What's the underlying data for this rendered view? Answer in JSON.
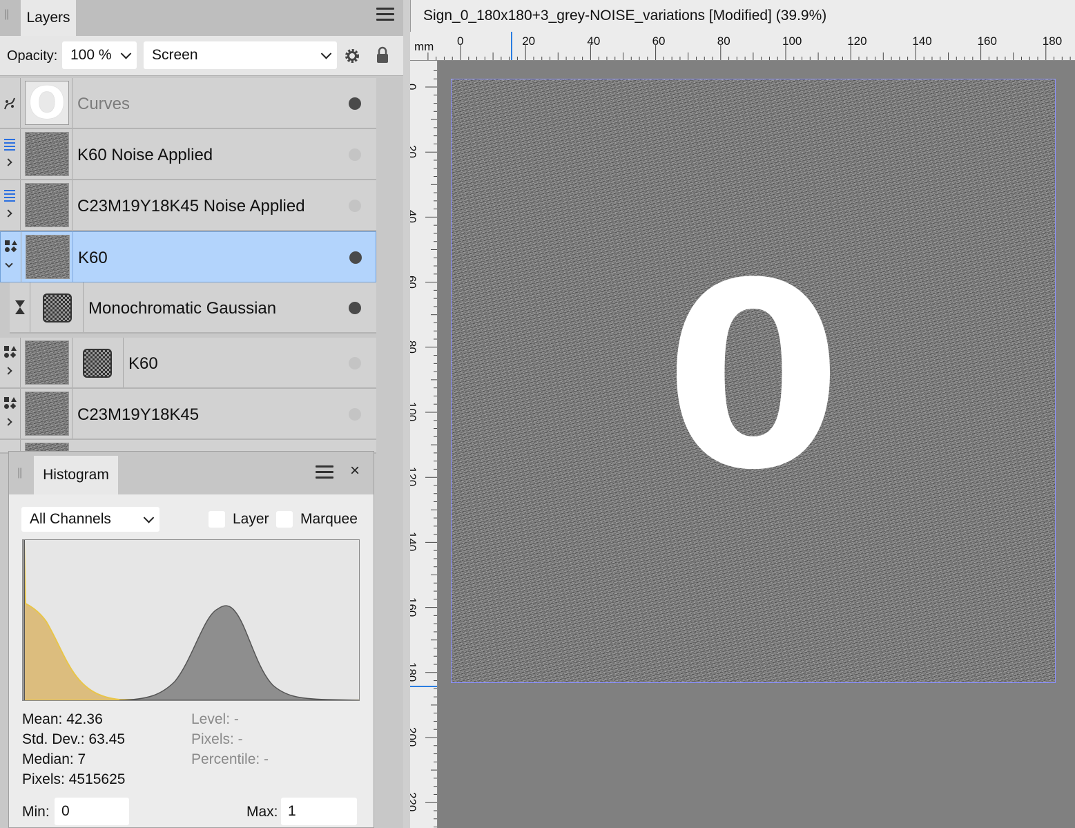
{
  "layers_panel": {
    "tab_label": "Layers",
    "opacity_label": "Opacity:",
    "opacity_value": "100 %",
    "blend_mode": "Screen",
    "layers": [
      {
        "name": "Curves",
        "type": "adjustment",
        "thumb": "O",
        "visible": true
      },
      {
        "name": "K60 Noise Applied",
        "type": "group",
        "visible": false
      },
      {
        "name": "C23M19Y18K45 Noise Applied",
        "type": "group",
        "visible": false
      },
      {
        "name": "K60",
        "type": "shape",
        "selected": true,
        "visible": true
      },
      {
        "name": "Monochromatic Gaussian",
        "type": "filter",
        "visible": true
      },
      {
        "name": "K60",
        "type": "shape-masked",
        "visible": false
      },
      {
        "name": "C23M19Y18K45",
        "type": "shape",
        "visible": false
      }
    ]
  },
  "histogram": {
    "tab_label": "Histogram",
    "channel": "All Channels",
    "layer_label": "Layer",
    "marquee_label": "Marquee",
    "mean": "Mean: 42.36",
    "std_dev": "Std. Dev.: 63.45",
    "median": "Median: 7",
    "pixels": "Pixels: 4515625",
    "level": "Level: -",
    "pixels_hover": "Pixels: -",
    "percentile": "Percentile: -",
    "min_label": "Min:",
    "min_value": "0",
    "max_label": "Max:",
    "max_value": "1",
    "colors": {
      "luma": "#dcbd7e",
      "luma_line": "#e8c54a",
      "grey": "#8e8e8e"
    }
  },
  "document": {
    "title": "Sign_0_180x180+3_grey-NOISE_variations [Modified] (39.9%)",
    "ruler_unit": "mm",
    "top_ticks": [
      "0",
      "20",
      "40",
      "60",
      "80",
      "100",
      "120",
      "140",
      "160",
      "180"
    ],
    "left_ticks": [
      "0",
      "20",
      "40",
      "60",
      "80",
      "100",
      "120",
      "140",
      "160",
      "180",
      "200",
      "220"
    ],
    "sign_text": "0"
  }
}
